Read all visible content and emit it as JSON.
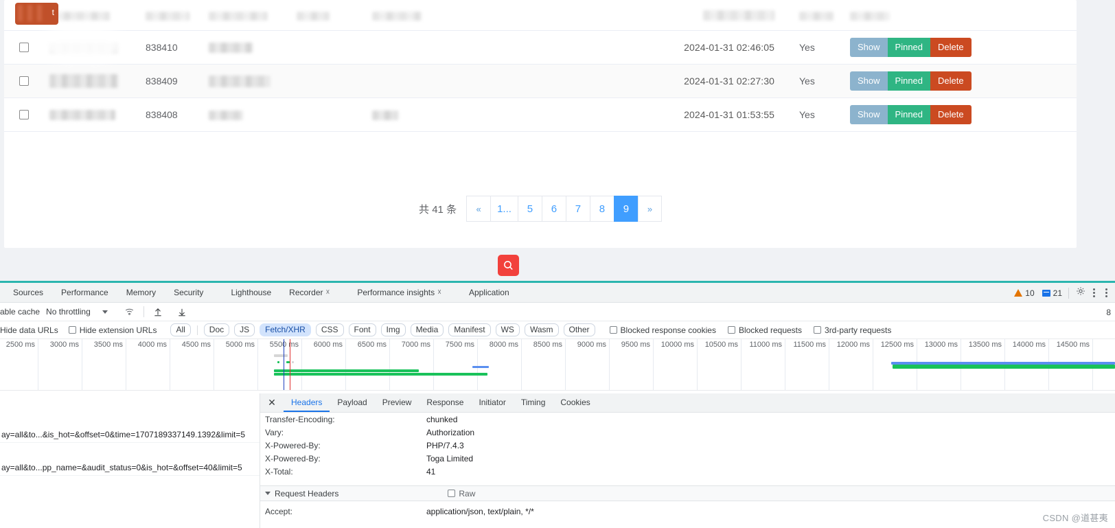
{
  "page": {
    "top_tag_label": "t",
    "table": {
      "columns": [
        "",
        "Name",
        "ID",
        "Col3",
        "Col4",
        "Col5",
        "Col6",
        "Time",
        "Pinned",
        "Actions"
      ],
      "rows": [
        {
          "id": "",
          "time": "",
          "yes": "",
          "redacted": true,
          "header": true
        },
        {
          "id": "838410",
          "time": "2024-01-31 02:46:05",
          "yes": "Yes"
        },
        {
          "id": "838409",
          "time": "2024-01-31 02:27:30",
          "yes": "Yes"
        },
        {
          "id": "838408",
          "time": "2024-01-31 01:53:55",
          "yes": "Yes"
        }
      ],
      "actions": {
        "show": "Show",
        "pinned": "Pinned",
        "delete": "Delete"
      },
      "action_colors": {
        "show": "#8cb3cd",
        "pinned": "#2fb583",
        "delete": "#cb4a21"
      }
    },
    "pagination": {
      "total_label": "共 41 条",
      "prev": "«",
      "next": "»",
      "pages": [
        "1...",
        "5",
        "6",
        "7",
        "8",
        "9"
      ],
      "active_page": "9",
      "active_color": "#409eff"
    },
    "search_fab": {
      "icon": "search-icon",
      "color": "#f2413c"
    }
  },
  "devtools": {
    "accent_color": "#2bb5ae",
    "panel_tabs": [
      {
        "label": "Sources",
        "flask": false
      },
      {
        "label": "Performance",
        "flask": false
      },
      {
        "label": "Memory",
        "flask": false
      },
      {
        "label": "Security",
        "flask": false
      },
      {
        "label": "Lighthouse",
        "flask": false
      },
      {
        "label": "Recorder",
        "flask": true
      },
      {
        "label": "Performance insights",
        "flask": true
      },
      {
        "label": "Application",
        "flask": false
      }
    ],
    "warnings_count": "10",
    "messages_count": "21",
    "settings_icon": "gear-icon",
    "more_icon": "kebab-menu-icon",
    "toolbar": {
      "disable_cache_label": "able cache",
      "throttling_value": "No throttling",
      "wifi_icon": "wifi-settings-icon",
      "import_icon": "upload-har-icon",
      "export_icon": "download-har-icon",
      "right_edge_label": "8"
    },
    "filterbar": {
      "hide_data_urls_label": "Hide data URLs",
      "hide_extension_urls_label": "Hide extension URLs",
      "type_chips": [
        "All",
        "Doc",
        "JS",
        "Fetch/XHR",
        "CSS",
        "Font",
        "Img",
        "Media",
        "Manifest",
        "WS",
        "Wasm",
        "Other"
      ],
      "active_chip": "Fetch/XHR",
      "blocked_response_cookies_label": "Blocked response cookies",
      "blocked_requests_label": "Blocked requests",
      "third_party_requests_label": "3rd-party requests"
    },
    "ruler": {
      "ticks": [
        "2500 ms",
        "3000 ms",
        "3500 ms",
        "4000 ms",
        "4500 ms",
        "5000 ms",
        "5500 ms",
        "6000 ms",
        "6500 ms",
        "7000 ms",
        "7500 ms",
        "8000 ms",
        "8500 ms",
        "9000 ms",
        "9500 ms",
        "10000 ms",
        "10500 ms",
        "11000 ms",
        "11500 ms",
        "12000 ms",
        "12500 ms",
        "13000 ms",
        "13500 ms",
        "14000 ms",
        "14500 ms"
      ]
    },
    "requests": [
      {
        "name": "ay=all&to...&is_hot=&offset=0&time=1707189337149.1392&limit=5",
        "selected": false
      },
      {
        "name": "ay=all&to...pp_name=&audit_status=0&is_hot=&offset=40&limit=5",
        "selected": false
      }
    ],
    "details": {
      "tabs": [
        "Headers",
        "Payload",
        "Preview",
        "Response",
        "Initiator",
        "Timing",
        "Cookies"
      ],
      "active_tab": "Headers",
      "close_icon": "close-icon",
      "response_headers": [
        {
          "key": "Transfer-Encoding:",
          "value": "chunked"
        },
        {
          "key": "Vary:",
          "value": "Authorization"
        },
        {
          "key": "X-Powered-By:",
          "value": "PHP/7.4.3"
        },
        {
          "key": "X-Powered-By:",
          "value": "Toga Limited"
        },
        {
          "key": "X-Total:",
          "value": "41"
        }
      ],
      "request_headers_section": {
        "title": "Request Headers",
        "raw_label": "Raw"
      },
      "request_headers": [
        {
          "key": "Accept:",
          "value": "application/json, text/plain, */*"
        }
      ]
    }
  },
  "watermark": "CSDN @道甚夷"
}
